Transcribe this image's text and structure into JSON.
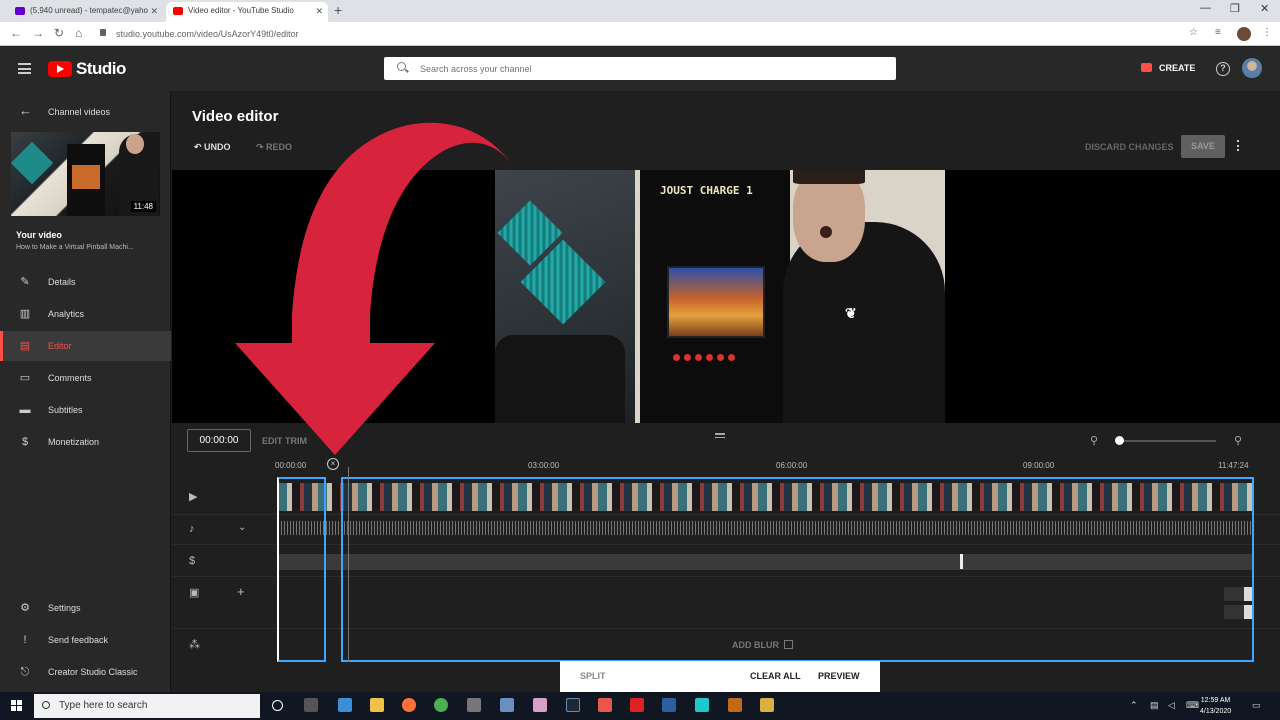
{
  "browser": {
    "tabs": [
      {
        "title": "(5,940 unread) - tempatec@yaho",
        "favicon_color": "#6001d2"
      },
      {
        "title": "Video editor - YouTube Studio",
        "favicon_color": "#ff0000"
      }
    ],
    "url": "studio.youtube.com/video/UsAzorY49t0/editor"
  },
  "header": {
    "brand": "Studio",
    "search_placeholder": "Search across your channel",
    "create_label": "CREATE"
  },
  "sidebar": {
    "back_label": "Channel videos",
    "thumbnail_duration": "11:48",
    "your_video_label": "Your video",
    "video_title": "How to Make a Virtual Pinball Machi...",
    "items": [
      {
        "label": "Details",
        "icon": "pencil-icon"
      },
      {
        "label": "Analytics",
        "icon": "analytics-icon"
      },
      {
        "label": "Editor",
        "icon": "editor-icon",
        "active": true
      },
      {
        "label": "Comments",
        "icon": "comments-icon"
      },
      {
        "label": "Subtitles",
        "icon": "subtitles-icon"
      },
      {
        "label": "Monetization",
        "icon": "dollar-icon"
      }
    ],
    "bottom_items": [
      {
        "label": "Settings",
        "icon": "gear-icon"
      },
      {
        "label": "Send feedback",
        "icon": "feedback-icon"
      },
      {
        "label": "Creator Studio Classic",
        "icon": "classic-icon"
      }
    ]
  },
  "editor": {
    "title": "Video editor",
    "undo_label": "UNDO",
    "redo_label": "REDO",
    "discard_label": "DISCARD CHANGES",
    "save_label": "SAVE",
    "video_marquee": "JOUST CHARGE 1",
    "timecode": "00:00:00",
    "edit_trim_label": "EDIT TRIM",
    "ruler_ticks": [
      "00:00:00",
      "03:00:00",
      "06:00:00",
      "09:00:00",
      "11:47:24"
    ],
    "add_blur_label": "ADD BLUR",
    "split_label": "SPLIT",
    "clear_all_label": "CLEAR ALL",
    "preview_label": "PREVIEW"
  },
  "taskbar": {
    "search_placeholder": "Type here to search",
    "time": "12:59 AM",
    "date": "4/13/2020"
  },
  "colors": {
    "accent_red": "#ff0000",
    "trim_blue": "#3ea6ff",
    "overlay_arrow": "#d8233c"
  }
}
